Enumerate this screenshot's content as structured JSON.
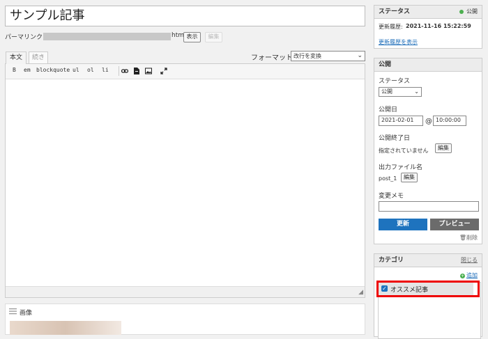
{
  "post": {
    "title": "サンプル記事",
    "permalink_label": "パーマリンク:",
    "permalink_suffix": "html",
    "view_button": "表示",
    "edit_button": "編集"
  },
  "editor": {
    "tabs": [
      "本文",
      "続き"
    ],
    "format_label": "フォーマット:",
    "format_value": "改行を変換",
    "toolbar": [
      "B",
      "em",
      "blockquote",
      "ul",
      "ol",
      "li"
    ],
    "toolbar_icons": [
      "link-icon",
      "file-icon",
      "image-icon",
      "fullscreen-icon"
    ]
  },
  "image_box": {
    "title": "画像"
  },
  "status_box": {
    "title": "ステータス",
    "public_badge": "公開",
    "updated_label": "更新履歴:",
    "updated_value": "2021-11-16 15:22:59",
    "history_link": "更新履歴を表示"
  },
  "publish_box": {
    "title": "公開",
    "status_label": "ステータス",
    "status_value": "公開",
    "date_label": "公開日",
    "date_value": "2021-02-01",
    "at": "@",
    "time_value": "10:00:00",
    "end_label": "公開終了日",
    "end_value": "指定されていません",
    "end_edit": "編集",
    "out_label": "出力ファイル名",
    "out_value": "post_1",
    "out_edit": "編集",
    "memo_label": "変更メモ",
    "memo_value": "",
    "update_button": "更新",
    "preview_button": "プレビュー",
    "delete_link": "削除"
  },
  "category_box": {
    "title": "カテゴリ",
    "close_link": "閉じる",
    "add_link": "追加",
    "items": [
      {
        "label": "オススメ記事",
        "checked": true
      }
    ]
  },
  "colors": {
    "accent": "#1e73be",
    "highlight": "#e00000",
    "public_dot": "#4caf50"
  }
}
